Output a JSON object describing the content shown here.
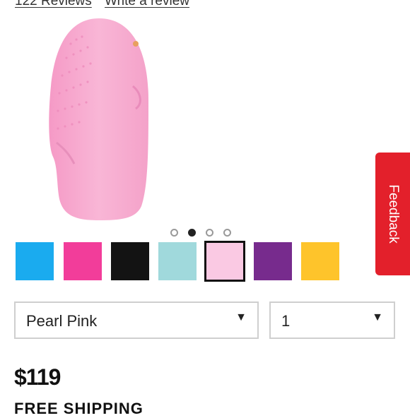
{
  "reviews": {
    "count_link": "122 Reviews",
    "write_link": "Write a review"
  },
  "product": {
    "image_icon": "facial-cleansing-brush-pink",
    "image_color": "#f7a9cf"
  },
  "carousel": {
    "page_count": 4,
    "active_index": 1
  },
  "swatches": [
    {
      "name": "blue",
      "color": "#1aabef"
    },
    {
      "name": "pink",
      "color": "#f23d9a"
    },
    {
      "name": "black",
      "color": "#131313"
    },
    {
      "name": "mint",
      "color": "#a0d9dc"
    },
    {
      "name": "pearl-pink",
      "color": "#fac9e3",
      "selected": true
    },
    {
      "name": "purple",
      "color": "#772b8d"
    },
    {
      "name": "yellow",
      "color": "#fec42b"
    }
  ],
  "color_select": {
    "value": "Pearl Pink"
  },
  "quantity_select": {
    "value": "1"
  },
  "price": "$119",
  "shipping": "FREE SHIPPING",
  "feedback": {
    "label": "Feedback",
    "color": "#e3202b"
  }
}
